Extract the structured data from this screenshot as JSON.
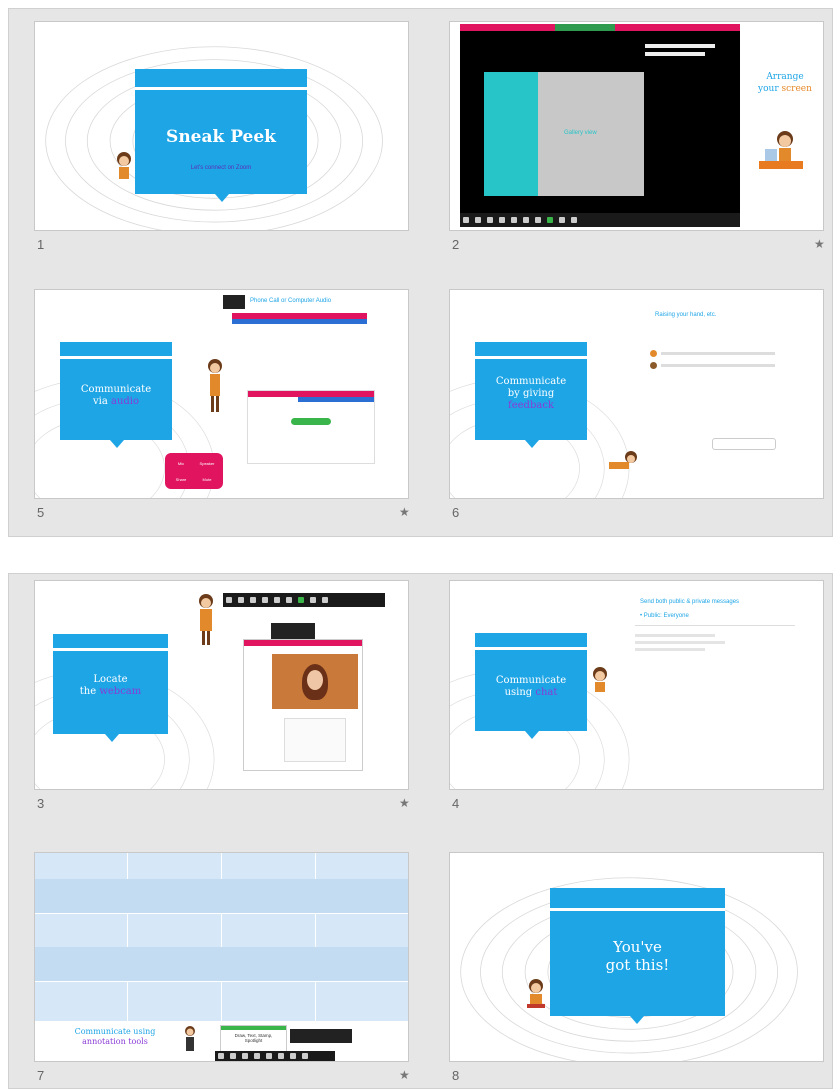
{
  "slides": {
    "s1": {
      "number": "1",
      "title": "Sneak Peek",
      "subtitle": "Let's connect on Zoom"
    },
    "s2": {
      "number": "2",
      "star": "★",
      "title_line1": "Arrange",
      "title_line2a": "your ",
      "title_line2b": "screen",
      "video_label": "Gallery view"
    },
    "s5": {
      "number": "5",
      "star": "★",
      "line1": "Communicate",
      "line2a": "via ",
      "line2b": "audio",
      "header": "Phone Call or Computer Audio",
      "badge_words": [
        "Mic",
        "Speaker",
        "Share",
        "Mute"
      ]
    },
    "s6": {
      "number": "6",
      "line1": "Communicate",
      "line2": "by giving",
      "line3": "feedback",
      "header": "Raising your hand, etc."
    },
    "s3": {
      "number": "3",
      "star": "★",
      "line1": "Locate",
      "line2a": "the ",
      "line2b": "webcam"
    },
    "s4": {
      "number": "4",
      "line1": "Communicate",
      "line2a": "using ",
      "line2b": "chat",
      "header": "Send both public & private messages",
      "bullet": "• Public: Everyone"
    },
    "s7": {
      "number": "7",
      "star": "★",
      "line1": "Communicate using",
      "line2": "annotation tools",
      "box_line1": "Draw, Text, Stamp,",
      "box_line2": "Spotlight"
    },
    "s8": {
      "number": "8",
      "line1": "You've",
      "line2": "got this!"
    }
  },
  "colors": {
    "accent_blue": "#1ea5e6",
    "accent_purple": "#8a3cd6",
    "zoom_pink": "#e0145f",
    "panel_bg": "#e6e6e6"
  }
}
